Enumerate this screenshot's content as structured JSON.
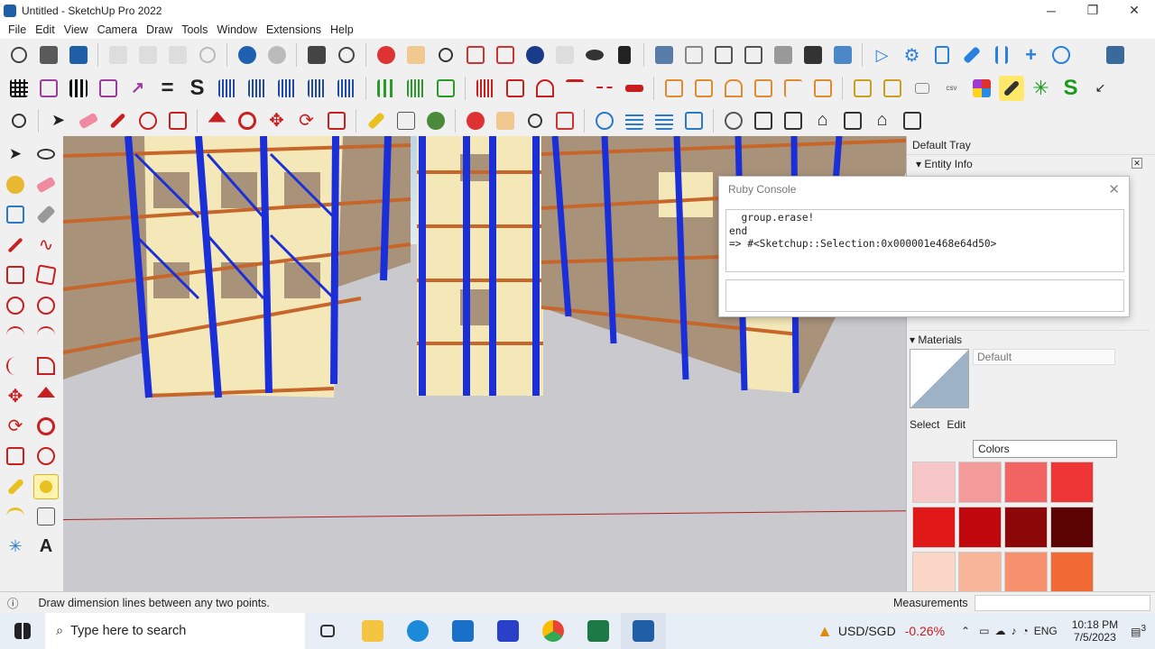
{
  "window": {
    "title": "Untitled - SketchUp Pro 2022",
    "minimize": "─",
    "maximize": "❐",
    "close": "✕"
  },
  "menu": [
    "File",
    "Edit",
    "View",
    "Camera",
    "Draw",
    "Tools",
    "Window",
    "Extensions",
    "Help"
  ],
  "ruby_console": {
    "title": "Ruby Console",
    "output": "  group.erase!\nend\n=> #<Sketchup::Selection:0x000001e468e64d50>",
    "input": ""
  },
  "tray": {
    "title": "Default Tray",
    "entity_info": "Entity Info",
    "materials": "Materials",
    "material_name": "Default",
    "tab_select": "Select",
    "tab_edit": "Edit",
    "collection": "Colors"
  },
  "swatches": [
    "#f7c6c6",
    "#f59a9a",
    "#f26464",
    "#ee3636",
    "#e01818",
    "#c0080e",
    "#8c0808",
    "#5c0303",
    "#f9d6c6",
    "#f8b59a",
    "#f7906c",
    "#f26a34"
  ],
  "status": {
    "text": "Draw dimension lines between any two points.",
    "measurements": "Measurements"
  },
  "taskbar": {
    "search_placeholder": "Type here to search",
    "ticker": "USD/SGD",
    "ticker_change": "-0.26%",
    "lang": "ENG",
    "time": "10:18 PM",
    "date": "7/5/2023",
    "notif_count": "3"
  },
  "colors": {
    "rack_blue": "#1a2fd8",
    "shelf_orange": "#c7662a",
    "box_cream": "#f5e8b8",
    "box_brown": "#a8927a",
    "floor": "#c9c9ce"
  }
}
